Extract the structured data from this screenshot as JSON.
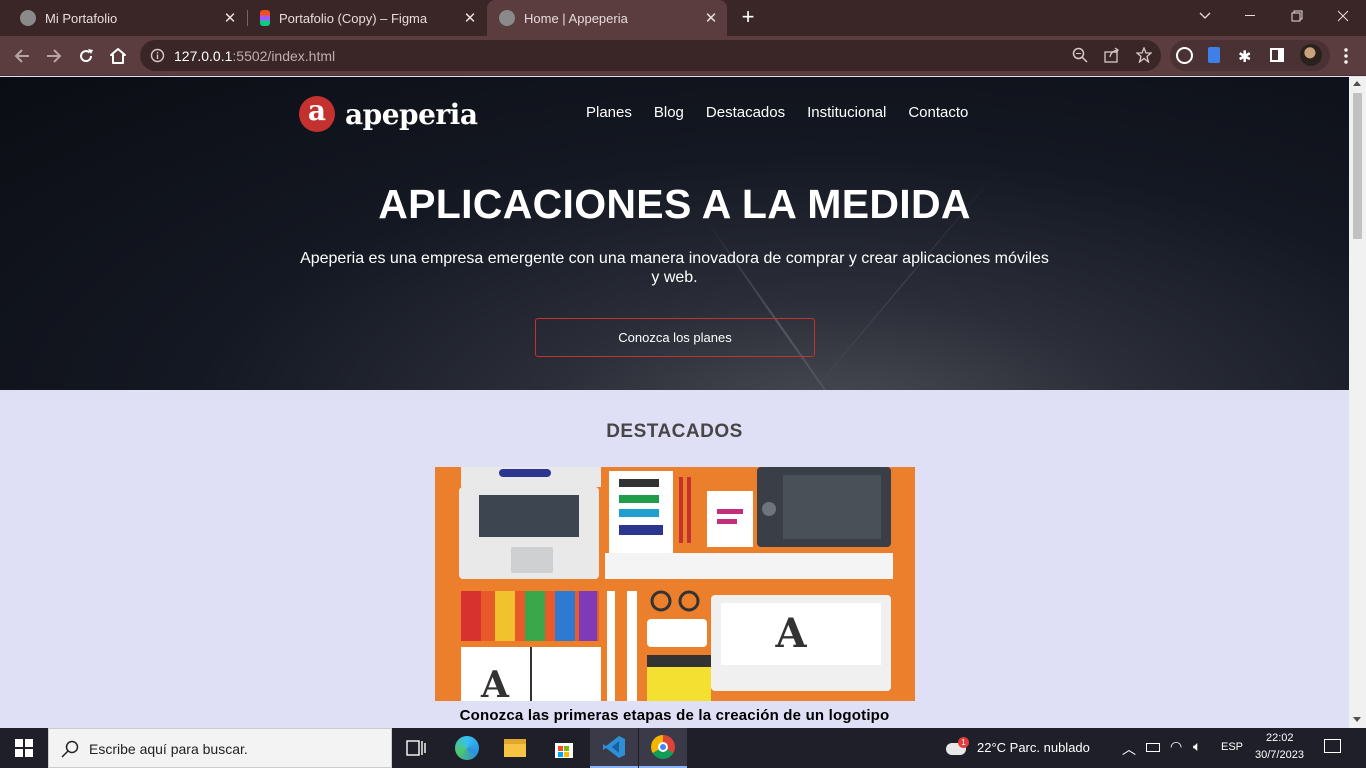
{
  "browser": {
    "tabs": [
      {
        "title": "Mi Portafolio",
        "favicon": "globe-icon",
        "active": false
      },
      {
        "title": "Portafolio (Copy) – Figma",
        "favicon": "figma-icon",
        "active": false
      },
      {
        "title": "Home | Appeperia",
        "favicon": "globe-icon",
        "active": true
      }
    ],
    "url_host": "127.0.0.1",
    "url_rest": ":5502/index.html"
  },
  "site": {
    "logo_text": "apeperia",
    "nav": [
      "Planes",
      "Blog",
      "Destacados",
      "Institucional",
      "Contacto"
    ],
    "hero_title": "APLICACIONES A LA MEDIDA",
    "hero_text": "Apeperia es una empresa emergente con una manera inovadora de comprar y crear aplicaciones móviles y web.",
    "cta_label": "Conozca los planes",
    "section_title": "DESTACADOS",
    "feature_caption": "Conozca las primeras etapas de la creación de un logotipo"
  },
  "taskbar": {
    "search_placeholder": "Escribe aquí para buscar.",
    "weather": "22°C  Parc. nublado",
    "lang": "ESP",
    "time": "22:02",
    "date": "30/7/2023",
    "weather_badge": "1"
  },
  "colors": {
    "brand_red": "#c4322f",
    "tab_bar": "#3b2627",
    "toolbar": "#5b3d3f",
    "page_bg": "#dfe0f5",
    "feature_bg": "#ec7f2b"
  }
}
